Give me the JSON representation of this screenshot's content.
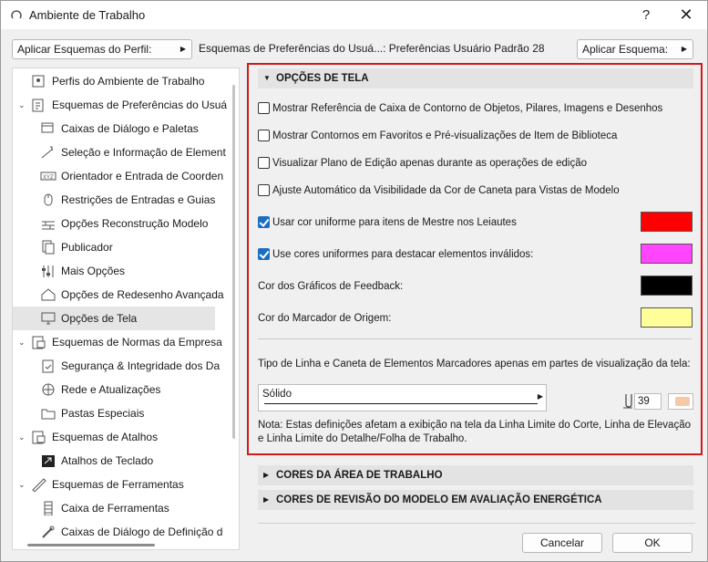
{
  "window": {
    "title": "Ambiente de Trabalho",
    "help": "?",
    "close": "✕"
  },
  "toolbar": {
    "profile_btn": "Aplicar Esquemas do Perfil:",
    "scheme_path": "Esquemas de Preferências do Usuá...: Preferências Usuário Padrão 28",
    "apply_btn": "Aplicar Esquema:"
  },
  "tree": [
    {
      "label": "Perfis do Ambiente de Trabalho",
      "icon": "profile-icon",
      "level": 0,
      "expander": ""
    },
    {
      "label": "Esquemas de Preferências do Usuá",
      "icon": "user-preferences-icon",
      "level": 0,
      "expander": "⌄"
    },
    {
      "label": "Caixas de Diálogo e Paletas",
      "icon": "dialog-palette-icon",
      "level": 1,
      "expander": ""
    },
    {
      "label": "Seleção e Informação de Element",
      "icon": "selection-info-icon",
      "level": 1,
      "expander": ""
    },
    {
      "label": "Orientador e Entrada de Coorden",
      "icon": "xyz-icon",
      "level": 1,
      "expander": ""
    },
    {
      "label": "Restrições de Entradas e Guias",
      "icon": "mouse-icon",
      "level": 1,
      "expander": ""
    },
    {
      "label": "Opções Reconstrução Modelo",
      "icon": "bricks-icon",
      "level": 1,
      "expander": ""
    },
    {
      "label": "Publicador",
      "icon": "publisher-icon",
      "level": 1,
      "expander": ""
    },
    {
      "label": "Mais Opções",
      "icon": "sliders-icon",
      "level": 1,
      "expander": ""
    },
    {
      "label": "Opções de Redesenho Avançada",
      "icon": "house-icon",
      "level": 1,
      "expander": ""
    },
    {
      "label": "Opções de Tela",
      "icon": "monitor-icon",
      "level": 1,
      "expander": "",
      "selected": true
    },
    {
      "label": "Esquemas de Normas da Empresa",
      "icon": "company-standards-icon",
      "level": 0,
      "expander": "⌄"
    },
    {
      "label": "Segurança & Integridade dos Da",
      "icon": "security-icon",
      "level": 1,
      "expander": ""
    },
    {
      "label": "Rede e Atualizações",
      "icon": "globe-icon",
      "level": 1,
      "expander": ""
    },
    {
      "label": "Pastas Especiais",
      "icon": "folders-icon",
      "level": 1,
      "expander": ""
    },
    {
      "label": "Esquemas de Atalhos",
      "icon": "shortcut-schemes-icon",
      "level": 0,
      "expander": "⌄"
    },
    {
      "label": "Atalhos de Teclado",
      "icon": "shortcut-icon",
      "level": 1,
      "expander": ""
    },
    {
      "label": "Esquemas de Ferramentas",
      "icon": "tool-schemes-icon",
      "level": 0,
      "expander": "⌄"
    },
    {
      "label": "Caixa de Ferramentas",
      "icon": "toolbox-icon",
      "level": 1,
      "expander": ""
    },
    {
      "label": "Caixas de Diálogo de Definição d",
      "icon": "tool-settings-icon",
      "level": 1,
      "expander": ""
    }
  ],
  "main": {
    "section_title": "OPÇÕES DE TELA",
    "checkboxes": [
      {
        "label": "Mostrar Referência de Caixa de Contorno de Objetos, Pilares, Imagens e Desenhos",
        "checked": false
      },
      {
        "label": "Mostrar Contornos em Favoritos e Pré-visualizações de Item de Biblioteca",
        "checked": false
      },
      {
        "label": "Visualizar Plano de Edição apenas durante as operações de edição",
        "checked": false
      },
      {
        "label": "Ajuste Automático da Visibilidade da Cor de Caneta para Vistas de Modelo",
        "checked": false
      }
    ],
    "color_options": [
      {
        "label": "Usar cor uniforme para itens de Mestre nos Leiautes",
        "checkbox": true,
        "checked": true,
        "color": "#ff0000"
      },
      {
        "label": "Use cores uniformes para destacar elementos inválidos:",
        "checkbox": true,
        "checked": true,
        "color": "#ff45ff"
      },
      {
        "label": "Cor dos Gráficos de Feedback:",
        "checkbox": false,
        "checked": false,
        "color": "#000000"
      },
      {
        "label": "Cor do Marcador de Origem:",
        "checkbox": false,
        "checked": false,
        "color": "#ffff99"
      }
    ],
    "line_desc": "Tipo de Linha e Caneta de Elementos Marcadores apenas em partes de visualização da tela:",
    "line_type": "Sólido",
    "pen_number": "39",
    "note": "Nota: Estas definições afetam a exibição na tela da Linha Limite do Corte, Linha de Elevação e Linha Limite do Detalhe/Folha de Trabalho."
  },
  "collapsed_sections": [
    "CORES DA ÁREA DE TRABALHO",
    "CORES DE REVISÃO DO MODELO EM AVALIAÇÃO ENERGÉTICA"
  ],
  "footer": {
    "cancel": "Cancelar",
    "ok": "OK"
  },
  "colors": {
    "frame": "#d11a1a",
    "check": "#1a6fc4",
    "selected_row": "#e5e5e5"
  }
}
